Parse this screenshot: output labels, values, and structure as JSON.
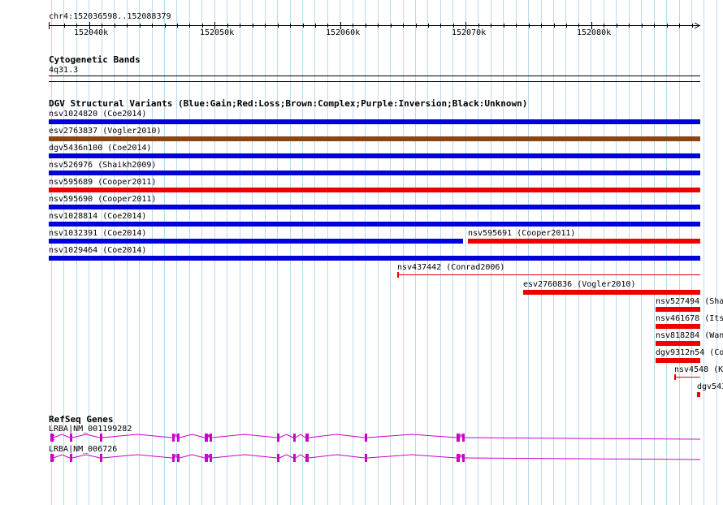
{
  "ruler": {
    "region": "chr4:152036598..152088379",
    "ticks": [
      "152040k",
      "152050k",
      "152060k",
      "152070k",
      "152080k"
    ]
  },
  "cytoband": {
    "title": "Cytogenetic Bands",
    "band": "4q31.3"
  },
  "dgv": {
    "title": "DGV Structural Variants (Blue:Gain;Red:Loss;Brown:Complex;Purple:Inversion;Black:Unknown)",
    "colors": {
      "gain": "#0000dd",
      "loss": "#ee0000",
      "complex": "#8b4513"
    },
    "variants": [
      {
        "label": "nsv1024820 (Coe2014)",
        "type": "gain"
      },
      {
        "label": "esv2763837 (Vogler2010)",
        "type": "complex"
      },
      {
        "label": "dgv5436n100 (Coe2014)",
        "type": "gain"
      },
      {
        "label": "nsv526976 (Shaikh2009)",
        "type": "gain"
      },
      {
        "label": "nsv595689 (Cooper2011)",
        "type": "loss"
      },
      {
        "label": "nsv595690 (Cooper2011)",
        "type": "gain"
      },
      {
        "label": "nsv1028814 (Coe2014)",
        "type": "gain"
      },
      {
        "label": "nsv1032391 (Coe2014)",
        "type": "gain"
      },
      {
        "label": "nsv595691 (Cooper2011)",
        "type": "loss"
      },
      {
        "label": "nsv1029464 (Coe2014)",
        "type": "gain"
      },
      {
        "label": "nsv437442 (Conrad2006)",
        "type": "loss"
      },
      {
        "label": "esv2760836 (Vogler2010)",
        "type": "loss"
      },
      {
        "label": "nsv527494 (Sha",
        "type": "loss"
      },
      {
        "label": "nsv461678 (Its",
        "type": "loss"
      },
      {
        "label": "nsv818284 (Wan",
        "type": "loss"
      },
      {
        "label": "dgv9312n54 (Co",
        "type": "loss"
      },
      {
        "label": "nsv4548 (K",
        "type": "loss"
      },
      {
        "label": "dgv543",
        "type": "loss"
      }
    ]
  },
  "refseq": {
    "title": "RefSeq Genes",
    "color": "#cc00cc",
    "genes": [
      {
        "label": "LRBA|NM_001199282"
      },
      {
        "label": "LRBA|NM_006726"
      }
    ]
  }
}
